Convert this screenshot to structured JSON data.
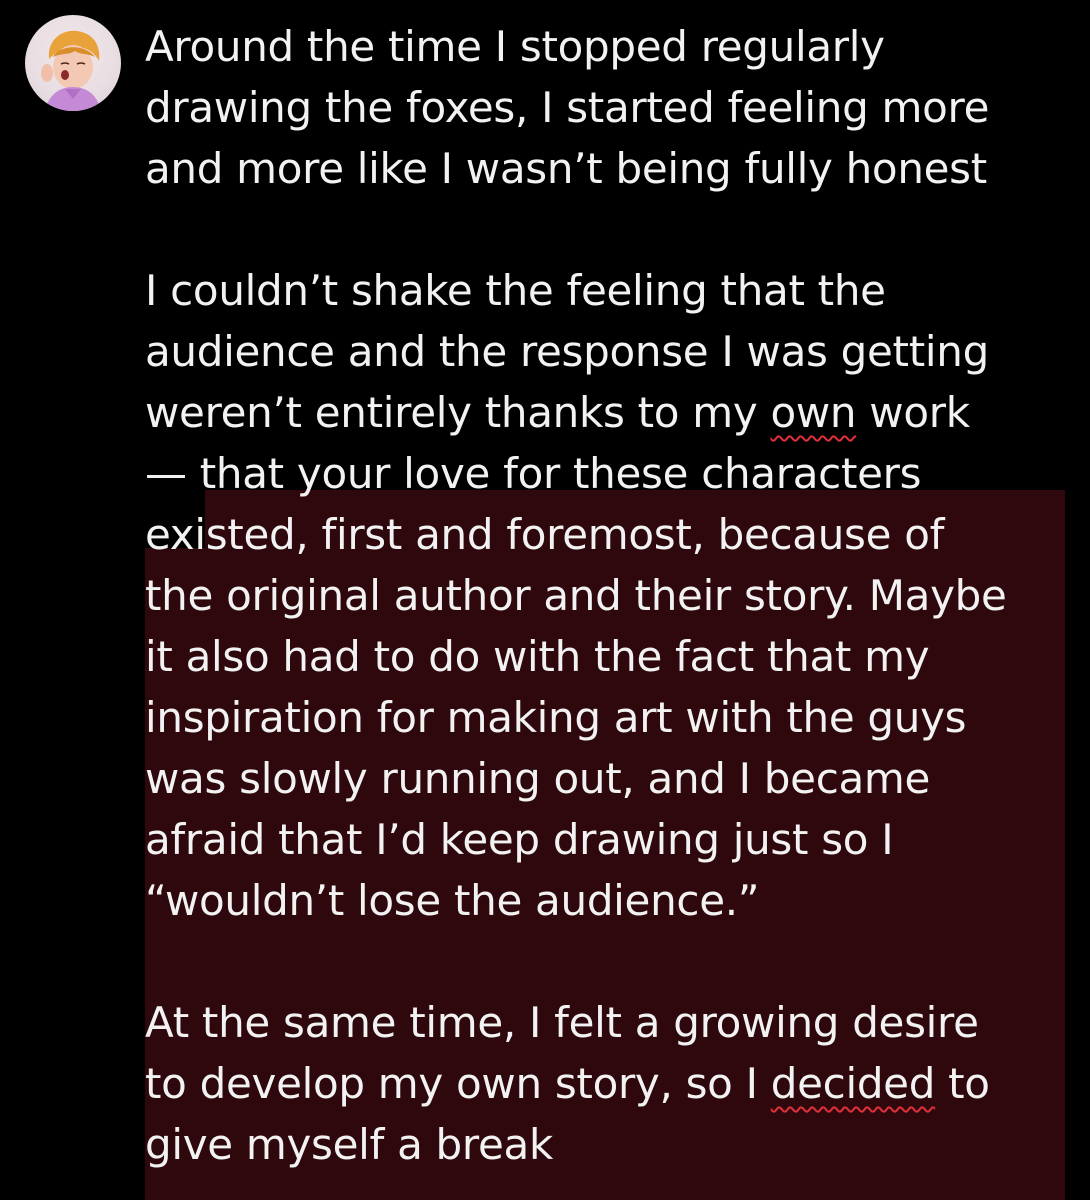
{
  "post": {
    "paragraph_1": [
      "Around the time I stopped regularly",
      "drawing the foxes, I started feeling more",
      "and more like I wasn’t being fully honest"
    ],
    "paragraph_2": {
      "line_1": "I couldn’t shake the feeling that the",
      "line_2": "audience and the response I was getting",
      "line_3_before": "weren’t entirely thanks to my ",
      "line_3_flagged": "own",
      "line_3_after": " work",
      "line_4": "— that your love for these characters",
      "line_5": "existed, first and foremost, because of",
      "line_6": "the original author and their story. Maybe",
      "line_7": "it also had to do with the fact that my",
      "line_8": "inspiration for making art with the guys",
      "line_9": "was slowly running out, and I became",
      "line_10": "afraid that I’d keep drawing just so I",
      "line_11": "“wouldn’t lose the audience.”"
    },
    "paragraph_3": {
      "line_1": "At the same time, I felt a growing desire",
      "line_2_before": "to develop my own story, so I ",
      "line_2_flagged": "decided",
      "line_2_after": " to",
      "line_3": "give myself a break"
    }
  },
  "colors": {
    "background": "#000000",
    "text": "#f2f2f2",
    "highlight": "#2e080c",
    "spellcheck_underline": "#e0303a"
  },
  "icons": {
    "avatar": "profile-avatar"
  }
}
